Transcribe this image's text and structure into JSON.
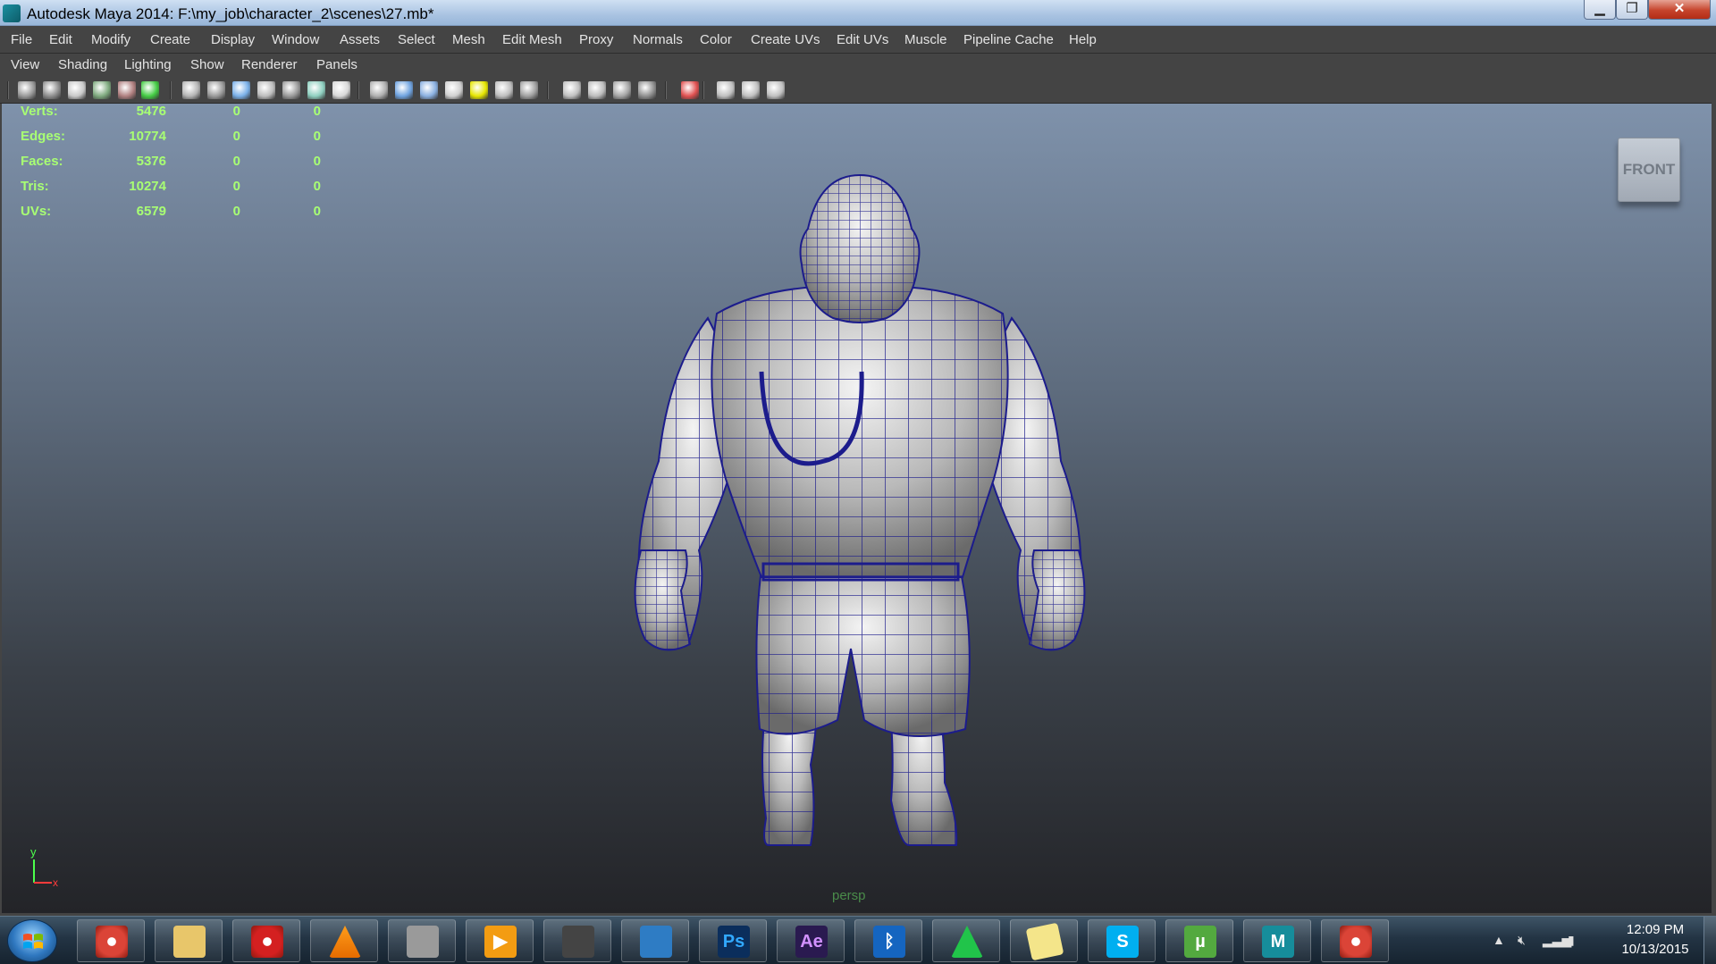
{
  "window": {
    "title": "Autodesk Maya 2014: F:\\my_job\\character_2\\scenes\\27.mb*",
    "minimize_icon": "minimize-icon",
    "maximize_icon": "restore-icon",
    "close_label": "✕"
  },
  "main_menu": [
    "File",
    "Edit",
    "Modify",
    "Create",
    "Display",
    "Window",
    "Assets",
    "Select",
    "Mesh",
    "Edit Mesh",
    "Proxy",
    "Normals",
    "Color",
    "Create UVs",
    "Edit UVs",
    "Muscle",
    "Pipeline Cache",
    "Help"
  ],
  "panel_menu": [
    "View",
    "Shading",
    "Lighting",
    "Show",
    "Renderer",
    "Panels"
  ],
  "hud": {
    "rows": [
      {
        "label": "Verts:",
        "a": "5476",
        "b": "0",
        "c": "0"
      },
      {
        "label": "Edges:",
        "a": "10774",
        "b": "0",
        "c": "0"
      },
      {
        "label": "Faces:",
        "a": "5376",
        "b": "0",
        "c": "0"
      },
      {
        "label": "Tris:",
        "a": "10274",
        "b": "0",
        "c": "0"
      },
      {
        "label": "UVs:",
        "a": "6579",
        "b": "0",
        "c": "0"
      }
    ],
    "color": "#a8ff73"
  },
  "viewcube": {
    "label": "FRONT"
  },
  "axis": {
    "y_label": "y",
    "x_label": "x",
    "y_color": "#4cff4c",
    "x_color": "#ff3b3b"
  },
  "camera": {
    "label": "persp"
  },
  "colors": {
    "wireframe": "#1c1c8c",
    "mesh": "#c8c8c8",
    "viewport_top": "#7f92ab",
    "viewport_bottom": "#232428"
  },
  "taskbar": {
    "apps": [
      {
        "name": "chrome",
        "icon": "chrome-icon",
        "glyph": ""
      },
      {
        "name": "file-explorer",
        "icon": "folder-icon",
        "glyph": ""
      },
      {
        "name": "record",
        "icon": "record-icon",
        "glyph": ""
      },
      {
        "name": "vlc",
        "icon": "vlc-cone-icon",
        "glyph": ""
      },
      {
        "name": "gear-app",
        "icon": "gears-icon",
        "glyph": ""
      },
      {
        "name": "media-player",
        "icon": "play-icon",
        "glyph": "▶"
      },
      {
        "name": "inkscape",
        "icon": "pen-icon",
        "glyph": ""
      },
      {
        "name": "download-manager",
        "icon": "globe-download-icon",
        "glyph": ""
      },
      {
        "name": "photoshop",
        "icon": "photoshop-icon",
        "glyph": "Ps"
      },
      {
        "name": "after-effects",
        "icon": "after-effects-icon",
        "glyph": "Ae"
      },
      {
        "name": "bluetooth",
        "icon": "bluetooth-icon",
        "glyph": "ᛒ"
      },
      {
        "name": "triangle-app",
        "icon": "green-triangle-icon",
        "glyph": ""
      },
      {
        "name": "notes",
        "icon": "sticky-notes-icon",
        "glyph": ""
      },
      {
        "name": "skype",
        "icon": "skype-icon",
        "glyph": "S"
      },
      {
        "name": "utorrent",
        "icon": "utorrent-icon",
        "glyph": "µ"
      },
      {
        "name": "maya",
        "icon": "maya-icon",
        "glyph": "M"
      },
      {
        "name": "chrome-2",
        "icon": "chrome-icon",
        "glyph": ""
      }
    ],
    "clock_time": "12:09 PM",
    "clock_date": "10/13/2015"
  }
}
